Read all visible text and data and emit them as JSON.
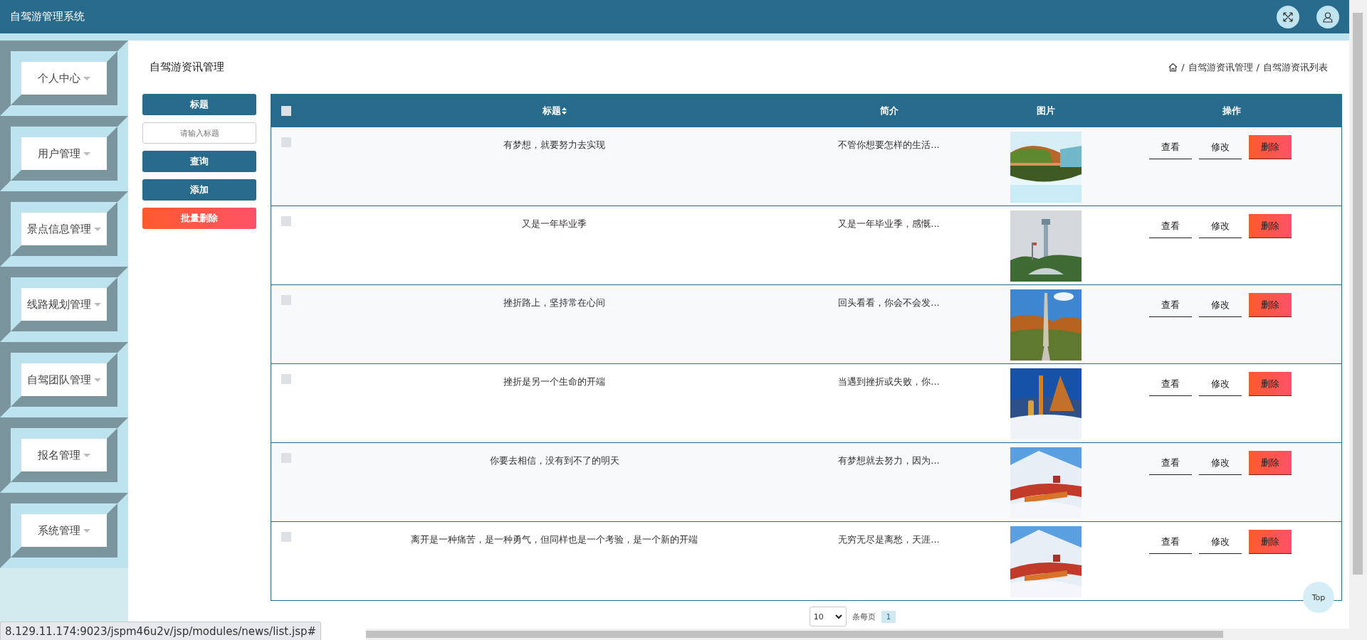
{
  "header": {
    "title": "自驾游管理系统"
  },
  "sidebar": {
    "items": [
      {
        "label": "个人中心"
      },
      {
        "label": "用户管理"
      },
      {
        "label": "景点信息管理"
      },
      {
        "label": "线路规划管理"
      },
      {
        "label": "自驾团队管理"
      },
      {
        "label": "报名管理"
      },
      {
        "label": "系统管理"
      }
    ]
  },
  "page_title": "自驾游资讯管理",
  "breadcrumb": {
    "separator": "/",
    "items": [
      "自驾游资讯管理",
      "自驾游资讯列表"
    ]
  },
  "filter": {
    "label": "标题",
    "placeholder": "请输入标题",
    "buttons": [
      {
        "label": "查询",
        "kind": "primary"
      },
      {
        "label": "添加",
        "kind": "primary"
      },
      {
        "label": "批量删除",
        "kind": "danger"
      }
    ]
  },
  "table": {
    "all_checked": false,
    "columns": [
      {
        "label": "标题",
        "sortable": true
      },
      {
        "label": "简介",
        "sortable": false
      },
      {
        "label": "图片",
        "sortable": false
      },
      {
        "label": "操作",
        "sortable": false
      }
    ],
    "rows": [
      {
        "checked": false,
        "title": "有梦想，就要努力去实现",
        "summary": "不管你想要怎样的生活...",
        "image": {
          "kind": "picture"
        },
        "actions": [
          {
            "label": "查看",
            "kind": "plain"
          },
          {
            "label": "修改",
            "kind": "plain"
          },
          {
            "label": "删除",
            "kind": "danger"
          }
        ]
      },
      {
        "checked": false,
        "title": "又是一年毕业季",
        "summary": "又是一年毕业季，感慨...",
        "image": {
          "kind": "picture"
        },
        "actions": [
          {
            "label": "查看",
            "kind": "plain"
          },
          {
            "label": "修改",
            "kind": "plain"
          },
          {
            "label": "删除",
            "kind": "danger"
          }
        ]
      },
      {
        "checked": false,
        "title": "挫折路上，坚持常在心间",
        "summary": "回头看看，你会不会发...",
        "image": {
          "kind": "picture"
        },
        "actions": [
          {
            "label": "查看",
            "kind": "plain"
          },
          {
            "label": "修改",
            "kind": "plain"
          },
          {
            "label": "删除",
            "kind": "danger"
          }
        ]
      },
      {
        "checked": false,
        "title": "挫折是另一个生命的开端",
        "summary": "当遇到挫折或失败，你...",
        "image": {
          "kind": "picture"
        },
        "actions": [
          {
            "label": "查看",
            "kind": "plain"
          },
          {
            "label": "修改",
            "kind": "plain"
          },
          {
            "label": "删除",
            "kind": "danger"
          }
        ]
      },
      {
        "checked": false,
        "title": "你要去相信，没有到不了的明天",
        "summary": "有梦想就去努力，因为...",
        "image": {
          "kind": "picture"
        },
        "actions": [
          {
            "label": "查看",
            "kind": "plain"
          },
          {
            "label": "修改",
            "kind": "plain"
          },
          {
            "label": "删除",
            "kind": "danger"
          }
        ]
      },
      {
        "checked": false,
        "title": "离开是一种痛苦，是一种勇气，但同样也是一个考验，是一个新的开端",
        "summary": "无穷无尽是离愁，天涯...",
        "image": {
          "kind": "picture"
        },
        "actions": [
          {
            "label": "查看",
            "kind": "plain"
          },
          {
            "label": "修改",
            "kind": "plain"
          },
          {
            "label": "删除",
            "kind": "danger"
          }
        ]
      }
    ]
  },
  "pagination": {
    "page_size": "10",
    "page_size_label": "条每页",
    "pages": [
      {
        "label": "1",
        "selected": true
      }
    ]
  },
  "top_button": "Top",
  "status_url": "8.129.11.174:9023/jspm46u2v/jsp/modules/news/list.jsp#"
}
